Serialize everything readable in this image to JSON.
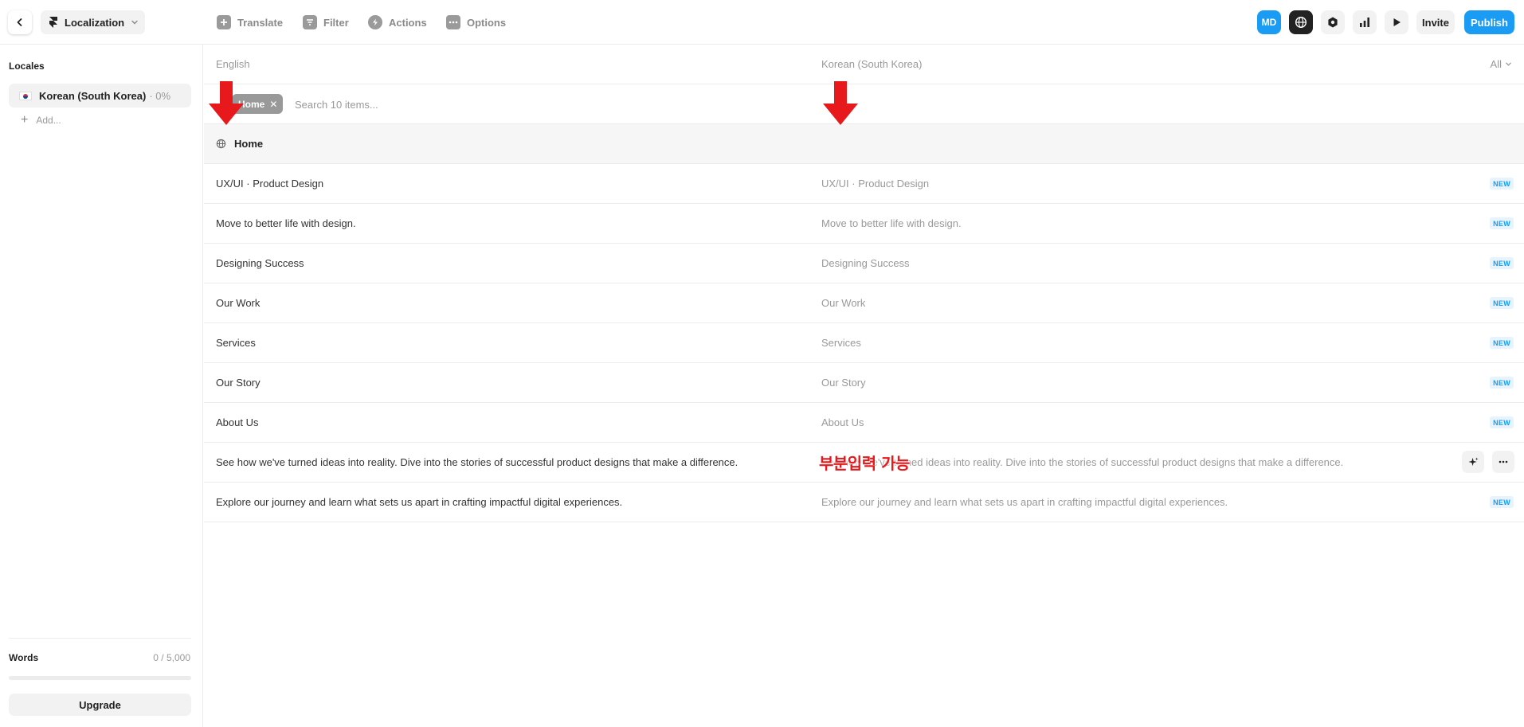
{
  "topbar": {
    "project_name": "Localization",
    "toolbar": [
      {
        "label": "Translate",
        "icon": "plus-square-icon"
      },
      {
        "label": "Filter",
        "icon": "filter-icon"
      },
      {
        "label": "Actions",
        "icon": "lightning-icon"
      },
      {
        "label": "Options",
        "icon": "more-dots-icon"
      }
    ],
    "avatar_initials": "MD",
    "invite_label": "Invite",
    "publish_label": "Publish",
    "accent_color": "#1a9cf5"
  },
  "sidebar": {
    "title": "Locales",
    "locales": [
      {
        "name": "Korean (South Korea)",
        "progress": "· 0%",
        "flag": "korea-flag-icon"
      }
    ],
    "add_label": "Add...",
    "words_label": "Words",
    "words_count": "0 / 5,000",
    "words_fraction": 0,
    "upgrade_label": "Upgrade"
  },
  "main": {
    "header": {
      "source_language": "English",
      "target_language": "Korean (South Korea)",
      "filter_label": "All"
    },
    "filter_chip": "Home",
    "search_placeholder": "Search 10 items...",
    "group_label": "Home",
    "rows": [
      {
        "source": "UX/UI · Product Design",
        "target": "UX/UI ·  Product Design",
        "badge": "NEW"
      },
      {
        "source": "Move to better life with design.",
        "target": "Move to better life with design.",
        "badge": "NEW"
      },
      {
        "source": "Designing Success",
        "target": "Designing Success",
        "badge": "NEW"
      },
      {
        "source": "Our Work",
        "target": "Our Work",
        "badge": "NEW"
      },
      {
        "source": "Services",
        "target": "Services",
        "badge": "NEW"
      },
      {
        "source": "Our Story",
        "target": "Our Story",
        "badge": "NEW"
      },
      {
        "source": "About Us",
        "target": "About Us",
        "badge": "NEW"
      },
      {
        "source": "See how we've turned ideas into reality. Dive into the stories of successful product designs that make a difference.",
        "target": "See how we've turned ideas into reality. Dive into the stories of successful product designs that make a difference.",
        "badge": ""
      },
      {
        "source": "Explore our journey and learn what sets us apart in crafting impactful digital experiences.",
        "target": "Explore our journey and learn what sets us apart in crafting impactful digital experiences.",
        "badge": "NEW"
      }
    ]
  },
  "annotation": {
    "text": "부분입력 가능",
    "color": "#e8191c"
  }
}
